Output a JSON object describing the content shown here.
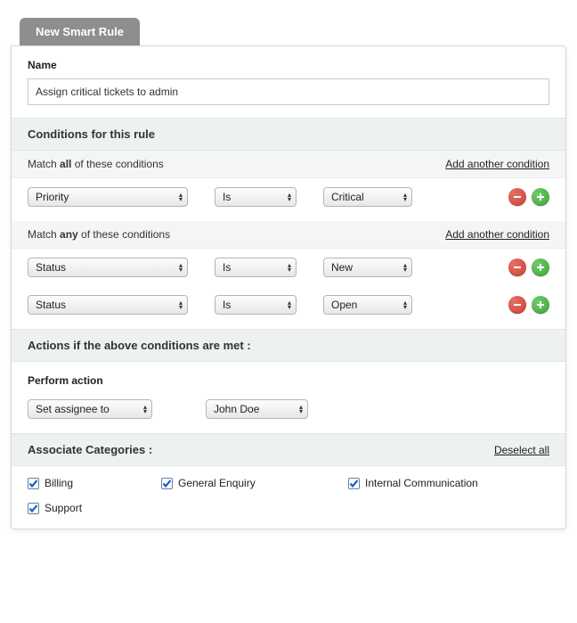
{
  "tab_title": "New Smart Rule",
  "name": {
    "label": "Name",
    "value": "Assign critical tickets to admin"
  },
  "conditions_header": "Conditions for this rule",
  "match_all": {
    "prefix": "Match ",
    "emph": "all",
    "suffix": " of these conditions",
    "add_link": "Add another condition",
    "rows": [
      {
        "field": "Priority",
        "op": "Is",
        "value": "Critical"
      }
    ]
  },
  "match_any": {
    "prefix": "Match ",
    "emph": "any",
    "suffix": " of these conditions",
    "add_link": "Add another condition",
    "rows": [
      {
        "field": "Status",
        "op": "Is",
        "value": "New"
      },
      {
        "field": "Status",
        "op": "Is",
        "value": "Open"
      }
    ]
  },
  "actions": {
    "header": "Actions if the above conditions are met :",
    "label": "Perform action",
    "action": "Set assignee to",
    "target": "John Doe"
  },
  "associate": {
    "header": "Associate Categories :",
    "deselect": "Deselect all",
    "items": [
      {
        "label": "Billing",
        "checked": true
      },
      {
        "label": "General Enquiry",
        "checked": true
      },
      {
        "label": "Internal Communication",
        "checked": true
      },
      {
        "label": "Support",
        "checked": true
      }
    ]
  }
}
